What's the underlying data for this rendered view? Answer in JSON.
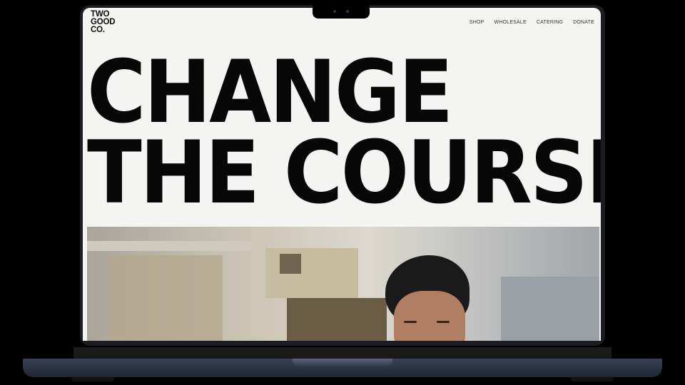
{
  "site": {
    "logo_lines": [
      "TWO",
      "GOOD",
      "CO."
    ],
    "nav": [
      "SHOP",
      "WHOLESALE",
      "CATERING",
      "DONATE"
    ],
    "headline_lines": [
      "CHANGE",
      "THE COURSE"
    ]
  },
  "hero_image": {
    "subject": "person-with-dark-hair"
  }
}
